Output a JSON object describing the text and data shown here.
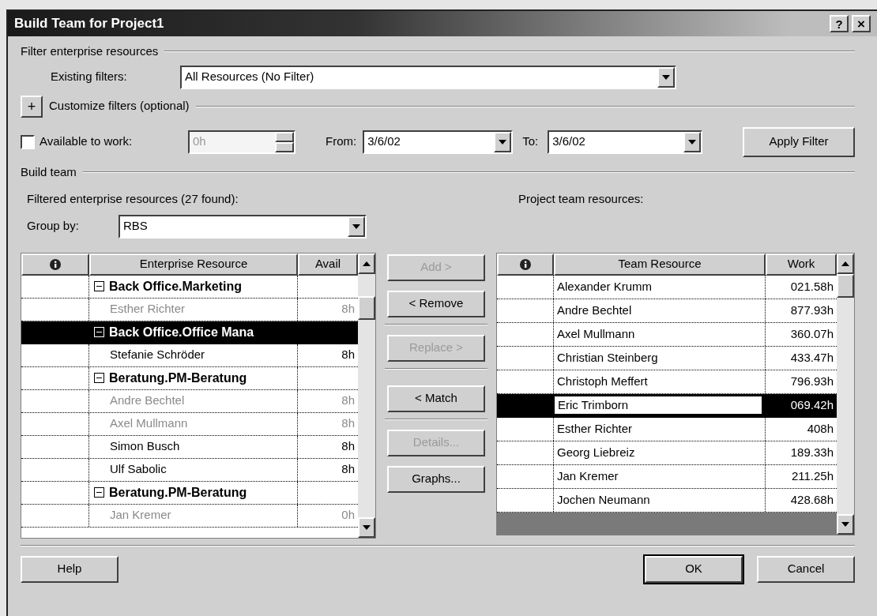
{
  "window": {
    "title": "Build Team for Project1",
    "help_button": "?",
    "close_button": "×"
  },
  "filter_section": {
    "heading": "Filter enterprise resources",
    "existing_filters": {
      "label": "Existing filters:",
      "value": "All Resources (No Filter)"
    },
    "customize": {
      "toggle": "+",
      "label": "Customize filters (optional)"
    },
    "available": {
      "label": "Available to work:",
      "checked": false,
      "value": "0h",
      "disabled": true
    },
    "from": {
      "label": "From:",
      "value": "3/6/02"
    },
    "to": {
      "label": "To:",
      "value": "3/6/02"
    },
    "apply_button": "Apply Filter"
  },
  "build_team": {
    "heading": "Build team",
    "filtered_label": "Filtered enterprise resources (27 found):",
    "group_by": {
      "label": "Group by:",
      "value": "RBS"
    },
    "team_label": "Project team resources:"
  },
  "resource_table": {
    "columns": [
      "Enterprise Resource",
      "Avail"
    ],
    "rows": [
      {
        "kind": "group",
        "name": "Back Office.Marketing",
        "expanded": true,
        "selected": false
      },
      {
        "kind": "resource",
        "name": "Esther Richter",
        "avail": "8h",
        "dimmed": true,
        "selected": false
      },
      {
        "kind": "group",
        "name": "Back Office.Office Mana",
        "expanded": true,
        "selected": true
      },
      {
        "kind": "resource",
        "name": "Stefanie Schröder",
        "avail": "8h",
        "dimmed": false,
        "selected": false
      },
      {
        "kind": "group",
        "name": "Beratung.PM-Beratung",
        "expanded": true,
        "selected": false
      },
      {
        "kind": "resource",
        "name": "Andre Bechtel",
        "avail": "8h",
        "dimmed": true,
        "selected": false
      },
      {
        "kind": "resource",
        "name": "Axel Mullmann",
        "avail": "8h",
        "dimmed": true,
        "selected": false
      },
      {
        "kind": "resource",
        "name": "Simon Busch",
        "avail": "8h",
        "dimmed": false,
        "selected": false
      },
      {
        "kind": "resource",
        "name": "Ulf Sabolic",
        "avail": "8h",
        "dimmed": false,
        "selected": false
      },
      {
        "kind": "group",
        "name": "Beratung.PM-Beratung",
        "expanded": true,
        "selected": false
      },
      {
        "kind": "resource",
        "name": "Jan Kremer",
        "avail": "0h",
        "dimmed": true,
        "selected": false
      }
    ]
  },
  "action_buttons": [
    {
      "label": "Add >",
      "disabled": true
    },
    {
      "label": "< Remove",
      "disabled": false
    },
    {
      "label": "Replace >",
      "disabled": true
    },
    {
      "label": "< Match",
      "disabled": false
    },
    {
      "label": "Details...",
      "disabled": true
    },
    {
      "label": "Graphs...",
      "disabled": false
    }
  ],
  "team_table": {
    "columns": [
      "Team Resource",
      "Work"
    ],
    "rows": [
      {
        "name": "Alexander Krumm",
        "work": "021.58h",
        "selected": false
      },
      {
        "name": "Andre Bechtel",
        "work": "877.93h",
        "selected": false
      },
      {
        "name": "Axel Mullmann",
        "work": "360.07h",
        "selected": false
      },
      {
        "name": "Christian Steinberg",
        "work": "433.47h",
        "selected": false
      },
      {
        "name": "Christoph Meffert",
        "work": "796.93h",
        "selected": false
      },
      {
        "name": "Eric Trimborn",
        "work": "069.42h",
        "selected": true
      },
      {
        "name": "Esther Richter",
        "work": "408h",
        "selected": false
      },
      {
        "name": "Georg Liebreiz",
        "work": "189.33h",
        "selected": false
      },
      {
        "name": "Jan Kremer",
        "work": "211.25h",
        "selected": false
      },
      {
        "name": "Jochen Neumann",
        "work": "428.68h",
        "selected": false
      }
    ]
  },
  "footer_buttons": [
    {
      "label": "Help",
      "default": false
    },
    {
      "label": "OK",
      "default": true
    },
    {
      "label": "Cancel",
      "default": false
    }
  ]
}
